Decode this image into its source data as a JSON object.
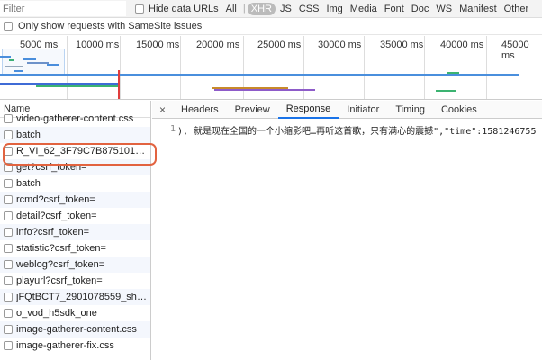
{
  "filter": {
    "placeholder": "Filter",
    "hide_data_urls": "Hide data URLs",
    "types": [
      "All",
      "XHR",
      "JS",
      "CSS",
      "Img",
      "Media",
      "Font",
      "Doc",
      "WS",
      "Manifest",
      "Other"
    ],
    "active_type": "XHR"
  },
  "samesite": {
    "label": "Only show requests with SameSite issues"
  },
  "timeline": {
    "ticks": [
      "5000 ms",
      "10000 ms",
      "15000 ms",
      "20000 ms",
      "25000 ms",
      "30000 ms",
      "35000 ms",
      "40000 ms",
      "45000 ms"
    ]
  },
  "list": {
    "header": "Name",
    "rows": [
      "video-gatherer-content.css",
      "batch",
      "R_VI_62_3F79C7B87510106...",
      "get?csrf_token=",
      "batch",
      "rcmd?csrf_token=",
      "detail?csrf_token=",
      "info?csrf_token=",
      "statistic?csrf_token=",
      "weblog?csrf_token=",
      "playurl?csrf_token=",
      "jFQtBCT7_2901078559_shd....",
      "o_vod_h5sdk_one",
      "image-gatherer-content.css",
      "image-gatherer-fix.css"
    ]
  },
  "tabs": {
    "close": "×",
    "items": [
      "Headers",
      "Preview",
      "Response",
      "Initiator",
      "Timing",
      "Cookies"
    ],
    "active": "Response"
  },
  "response": {
    "line_number": "1",
    "text": "), 就是现在全国的一个小缩影吧…再听这首歌，只有满心的震撼\",\"time\":1581246755"
  },
  "colors": {
    "highlight": "#e26340",
    "active_tab": "#1a73e8",
    "active_type_bg": "#bbbbbb"
  }
}
